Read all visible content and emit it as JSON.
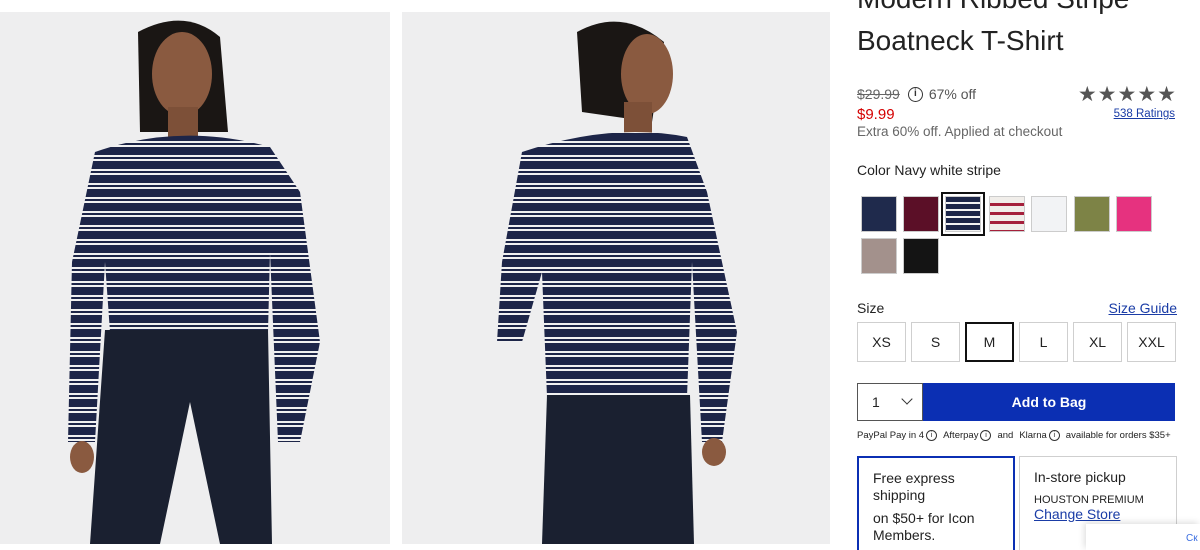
{
  "product": {
    "title_line1": "Modern Ribbed Stripe",
    "title_line2": "Boatneck T-Shirt",
    "original_price": "$29.99",
    "info_icon": "i",
    "percent_off": "67% off",
    "sale_price": "$9.99",
    "promo_note": "Extra 60% off. Applied at checkout",
    "stars": "★★★★★",
    "rating_count": "538 Ratings"
  },
  "color": {
    "label": "Color Navy white stripe",
    "swatches": [
      {
        "name": "navy",
        "hex": "#1f2a4c"
      },
      {
        "name": "burgundy",
        "hex": "#5b0f27"
      },
      {
        "name": "navy-white-stripe",
        "hex": "#1c2548",
        "selected": true
      },
      {
        "name": "cream-red-stripe",
        "hex": "#a5203b"
      },
      {
        "name": "white",
        "hex": "#f2f3f5"
      },
      {
        "name": "olive",
        "hex": "#7d8346"
      },
      {
        "name": "pink",
        "hex": "#e6327f"
      },
      {
        "name": "taupe",
        "hex": "#a3918c"
      },
      {
        "name": "black",
        "hex": "#141414"
      }
    ]
  },
  "size": {
    "label": "Size",
    "guide_link": "Size Guide",
    "options": [
      "XS",
      "S",
      "M",
      "L",
      "XL",
      "XXL"
    ],
    "selected": "M"
  },
  "purchase": {
    "quantity": "1",
    "add_to_bag": "Add to Bag",
    "pay_paypal": "PayPal Pay in 4",
    "pay_afterpay": "Afterpay",
    "pay_and": "and",
    "pay_klarna": "Klarna",
    "pay_note": "available for orders $35+"
  },
  "shipping": {
    "title": "Free express shipping",
    "subtitle": "on $50+ for Icon Members."
  },
  "pickup": {
    "title": "In-store pickup",
    "store": "HOUSTON PREMIUM",
    "change_link": "Change Store"
  },
  "chat": {
    "label": "Ск"
  },
  "colors": {
    "accent": "#0b2fb3",
    "sale": "#d40000",
    "link": "#1a3ca6"
  }
}
